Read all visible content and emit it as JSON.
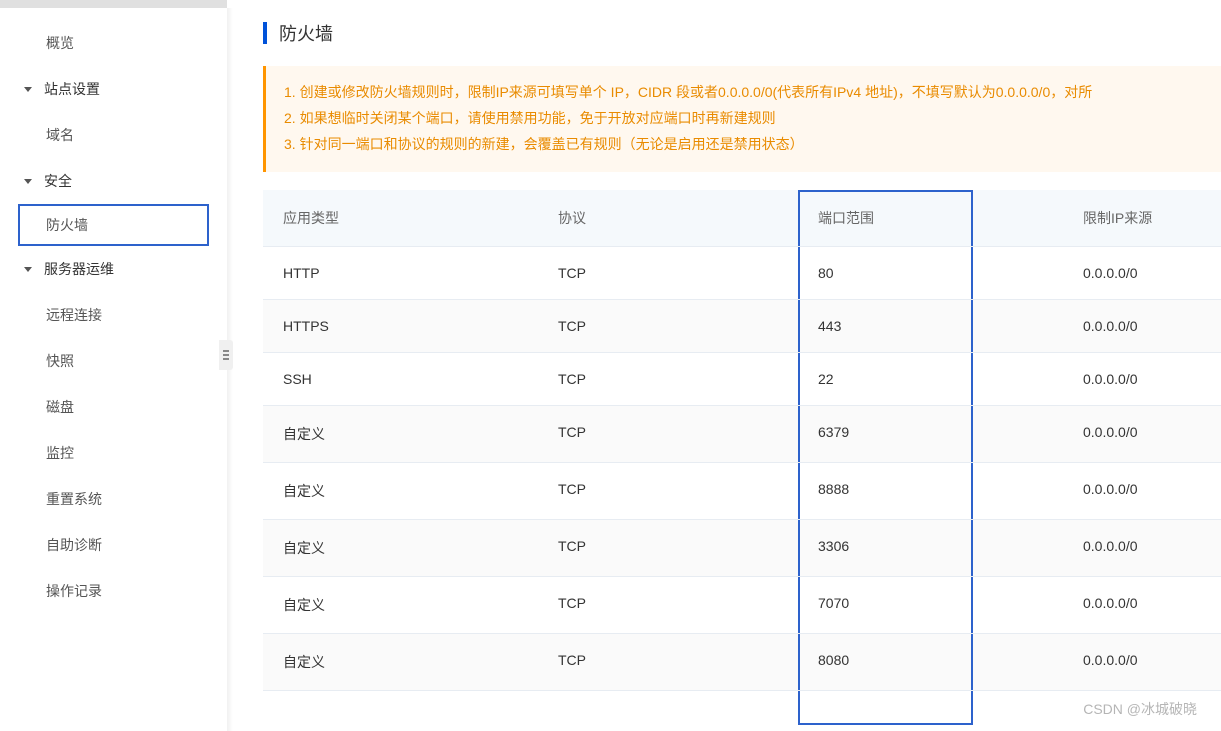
{
  "sidebar": {
    "items": [
      {
        "label": "概览",
        "child": true
      },
      {
        "label": "站点设置",
        "parent": true
      },
      {
        "label": "域名",
        "child": true
      },
      {
        "label": "安全",
        "parent": true
      },
      {
        "label": "防火墙",
        "child": true,
        "active": true
      },
      {
        "label": "服务器运维",
        "parent": true
      },
      {
        "label": "远程连接",
        "child": true
      },
      {
        "label": "快照",
        "child": true
      },
      {
        "label": "磁盘",
        "child": true
      },
      {
        "label": "监控",
        "child": true
      },
      {
        "label": "重置系统",
        "child": true
      },
      {
        "label": "自助诊断",
        "child": true
      },
      {
        "label": "操作记录",
        "child": true
      }
    ]
  },
  "page": {
    "title": "防火墙"
  },
  "notice": {
    "line1": "1. 创建或修改防火墙规则时，限制IP来源可填写单个 IP，CIDR 段或者0.0.0.0/0(代表所有IPv4 地址)，不填写默认为0.0.0.0/0，对所",
    "line2": "2. 如果想临时关闭某个端口，请使用禁用功能，免于开放对应端口时再新建规则",
    "line3": "3. 针对同一端口和协议的规则的新建，会覆盖已有规则（无论是启用还是禁用状态）"
  },
  "table": {
    "headers": {
      "app_type": "应用类型",
      "protocol": "协议",
      "port_range": "端口范围",
      "ip_limit": "限制IP来源"
    },
    "rows": [
      {
        "app_type": "HTTP",
        "protocol": "TCP",
        "port_range": "80",
        "ip_limit": "0.0.0.0/0"
      },
      {
        "app_type": "HTTPS",
        "protocol": "TCP",
        "port_range": "443",
        "ip_limit": "0.0.0.0/0"
      },
      {
        "app_type": "SSH",
        "protocol": "TCP",
        "port_range": "22",
        "ip_limit": "0.0.0.0/0"
      },
      {
        "app_type": "自定义",
        "protocol": "TCP",
        "port_range": "6379",
        "ip_limit": "0.0.0.0/0"
      },
      {
        "app_type": "自定义",
        "protocol": "TCP",
        "port_range": "8888",
        "ip_limit": "0.0.0.0/0"
      },
      {
        "app_type": "自定义",
        "protocol": "TCP",
        "port_range": "3306",
        "ip_limit": "0.0.0.0/0"
      },
      {
        "app_type": "自定义",
        "protocol": "TCP",
        "port_range": "7070",
        "ip_limit": "0.0.0.0/0"
      },
      {
        "app_type": "自定义",
        "protocol": "TCP",
        "port_range": "8080",
        "ip_limit": "0.0.0.0/0"
      }
    ]
  },
  "watermark": "CSDN @冰城破晓"
}
